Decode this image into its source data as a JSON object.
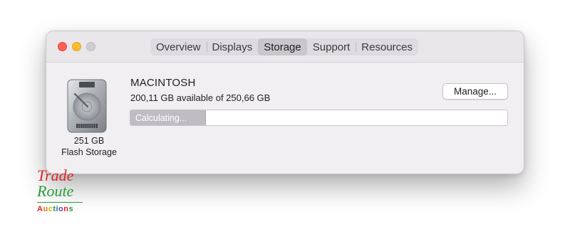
{
  "window": {
    "tabs": [
      {
        "label": "Overview",
        "active": false
      },
      {
        "label": "Displays",
        "active": false
      },
      {
        "label": "Storage",
        "active": true
      },
      {
        "label": "Support",
        "active": false
      },
      {
        "label": "Resources",
        "active": false
      }
    ]
  },
  "disk": {
    "icon": "hard-drive-icon",
    "size_label": "251 GB",
    "kind_label": "Flash Storage"
  },
  "volume": {
    "name": "MACINTOSH",
    "availability": "200,11 GB available of 250,66 GB",
    "manage_label": "Manage...",
    "bar_status": "Calculating...",
    "bar_fill_fraction": 0.2
  },
  "watermark": {
    "line1": "Trade",
    "line2": "Route",
    "line3_letters": [
      "A",
      "u",
      "c",
      "t",
      "i",
      "o",
      "n",
      "s"
    ],
    "line3_colors": [
      "#d8262c",
      "#e07a1c",
      "#d9b40f",
      "#2a9a3a",
      "#1f6fc1",
      "#7a3ea8",
      "#d8262c",
      "#2a9a3a"
    ]
  },
  "colors": {
    "close": "#fd5f57",
    "minimize": "#febc2e",
    "zoom_inactive": "#d0ced2"
  }
}
